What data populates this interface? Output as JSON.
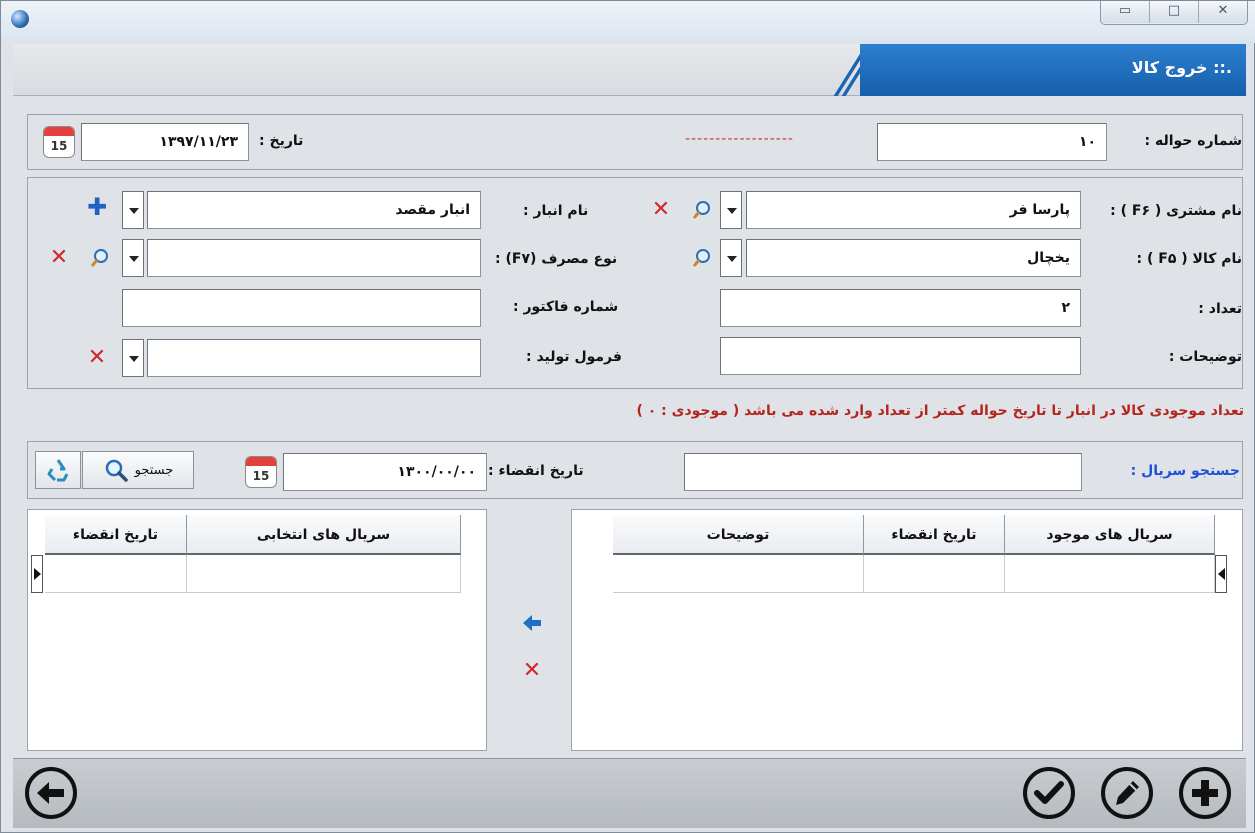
{
  "window": {
    "caption_buttons": [
      "▭",
      "□",
      "✕"
    ]
  },
  "form": {
    "title": ".:: خروج کالا"
  },
  "header_row": {
    "voucher_number_label": "شماره حواله :",
    "voucher_number_value": "۱۰",
    "dashes": "------------------",
    "date_label": "تاریخ :",
    "date_value": "۱۳۹۷/۱۱/۲۳",
    "calendar_day": "15"
  },
  "details": {
    "customer_label": "نام مشتری ( F۶ ) :",
    "customer_value": "پارسا فر",
    "warehouse_label": "نام انبار :",
    "warehouse_value": "انبار مقصد",
    "product_label": "نام کالا  ( F۵ ) :",
    "product_value": "یخچال",
    "usage_type_label": "نوع مصرف (F۷) :",
    "usage_type_value": "",
    "quantity_label": "تعداد :",
    "quantity_value": "۲",
    "invoice_label": "شماره فاکتور :",
    "invoice_value": "",
    "description_label": "توضیحات :",
    "description_value": "",
    "formula_label": "فرمول تولید :",
    "formula_value": ""
  },
  "warning": "تعداد موجودی کالا در انبار تا تاریخ حواله کمتر از تعداد وارد شده می باشد  ( موجودی : ۰ )",
  "serial_search": {
    "label": "جستجو سریال :",
    "value": "",
    "expiry_label": "تاریخ انقضاء :",
    "expiry_value": "۱۳۰۰/۰۰/۰۰",
    "calendar_day": "15",
    "search_button": "جستجو"
  },
  "available_grid": {
    "columns": [
      "سریال های موجود",
      "تاریخ انقضاء",
      "توضیحات"
    ]
  },
  "selected_grid": {
    "columns": [
      "سریال های انتخابی",
      "تاریخ انقضاء"
    ]
  },
  "colors": {
    "accent_blue": "#1f6fc2",
    "warning_red": "#b3261e",
    "serial_label_blue": "#1e4fd6"
  },
  "icons": {
    "transfer": "arrow-left-icon",
    "remove": "close-icon",
    "back": "back-arrow-icon",
    "confirm": "check-icon",
    "edit": "pencil-icon",
    "add": "plus-icon"
  }
}
